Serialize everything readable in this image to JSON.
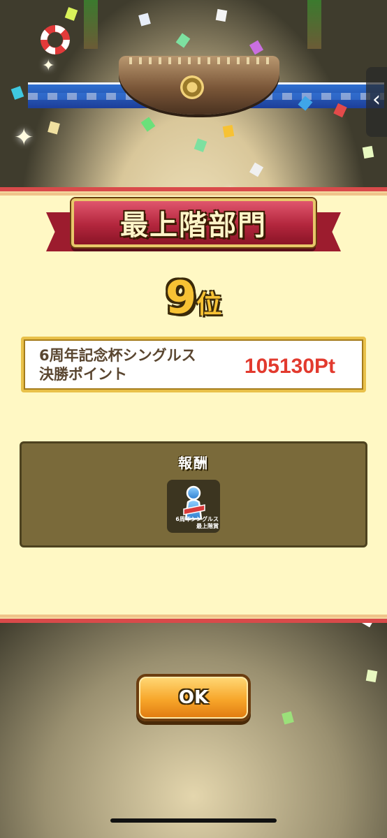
{
  "result": {
    "category_title": "最上階部門",
    "rank_number": "9",
    "rank_suffix": "位",
    "score_label": "6周年記念杯シングルス 決勝ポイント",
    "score_value": "105130Pt"
  },
  "reward": {
    "title": "報酬",
    "item_caption_line1": "6周年シングルス",
    "item_caption_line2": "最上階賞",
    "item_icon": "trophy-figure-icon"
  },
  "actions": {
    "ok_label": "OK"
  },
  "colors": {
    "banner": "#b3263d",
    "panel": "#fff8c4",
    "score_value": "#e23a2e",
    "rank_gold": "#f7c234",
    "button": "#f7a62a"
  }
}
